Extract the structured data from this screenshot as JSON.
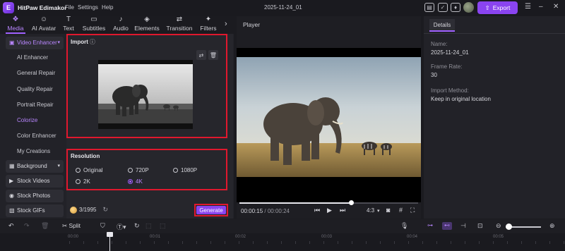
{
  "app": {
    "name": "HitPaw Edimakor",
    "menu": [
      "File",
      "Settings",
      "Help"
    ],
    "project_title": "2025-11-24_01",
    "export_label": "Export"
  },
  "toolbar": {
    "tabs": [
      {
        "label": "Media",
        "icon": "media-icon",
        "active": true
      },
      {
        "label": "AI Avatar",
        "icon": "ai-avatar-icon"
      },
      {
        "label": "Text",
        "icon": "text-icon"
      },
      {
        "label": "Subtitles",
        "icon": "subtitles-icon"
      },
      {
        "label": "Audio",
        "icon": "audio-icon"
      },
      {
        "label": "Elements",
        "icon": "elements-icon"
      },
      {
        "label": "Transition",
        "icon": "transition-icon"
      },
      {
        "label": "Filters",
        "icon": "filters-icon"
      }
    ]
  },
  "sidebar": {
    "video_enhancer": "Video Enhancer",
    "items": [
      "AI Enhancer",
      "General Repair",
      "Quality Repair",
      "Portrait Repair",
      "Colorize",
      "Color Enhancer",
      "My Creations"
    ],
    "selected": "Colorize",
    "categories": [
      "Background",
      "Stock Videos",
      "Stock Photos",
      "Stock GIFs"
    ]
  },
  "import": {
    "title": "Import",
    "info_icon": "ⓘ"
  },
  "resolution": {
    "title": "Resolution",
    "options": [
      "Original",
      "720P",
      "1080P",
      "2K",
      "4K"
    ],
    "selected": "4K"
  },
  "footer": {
    "credits": "3/1995",
    "generate_label": "Generate"
  },
  "player": {
    "title": "Player",
    "current_time": "00:00:15",
    "total_time": "00:00:24",
    "progress": 0.625,
    "aspect_ratio": "4:3"
  },
  "details": {
    "tab": "Details",
    "name_label": "Name:",
    "name_value": "2025-11-24_01",
    "frame_rate_label": "Frame Rate:",
    "frame_rate_value": "30",
    "import_method_label": "Import Method:",
    "import_method_value": "Keep in original location"
  },
  "timeline": {
    "split_label": "Split",
    "ticks": [
      "00:00",
      "00:01",
      "00:02",
      "00:03",
      "00:04",
      "00:05"
    ]
  },
  "colors": {
    "accent": "#8a44f0",
    "highlight_border": "#e0182e",
    "background": "#1b1b20"
  }
}
